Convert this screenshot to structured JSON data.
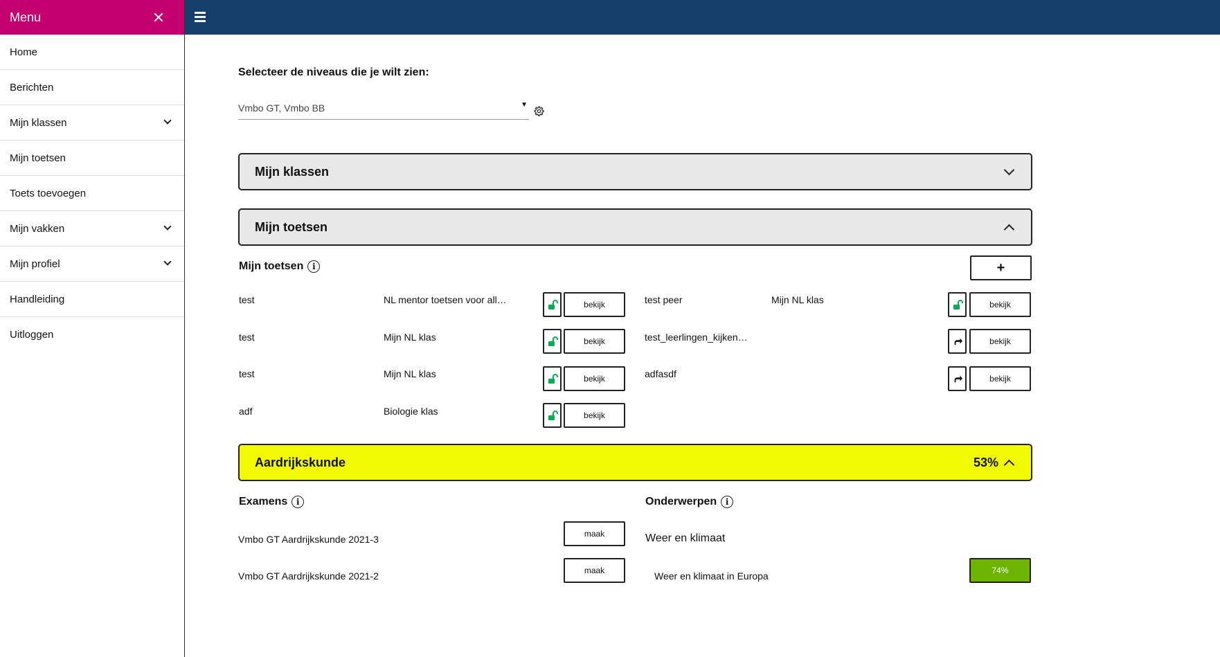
{
  "sidebar": {
    "title": "Menu",
    "items": [
      {
        "label": "Home"
      },
      {
        "label": "Berichten"
      },
      {
        "label": "Mijn klassen"
      },
      {
        "label": "Mijn toetsen"
      },
      {
        "label": "Toets toevoegen"
      },
      {
        "label": "Mijn vakken"
      },
      {
        "label": "Mijn profiel"
      },
      {
        "label": "Handleiding"
      },
      {
        "label": "Uitloggen"
      }
    ]
  },
  "levels": {
    "label": "Selecteer de niveaus die je wilt zien:",
    "selected": "Vmbo GT, Vmbo BB"
  },
  "panels": {
    "klassen": "Mijn klassen",
    "toetsen": "Mijn toetsen",
    "aardrijkskunde": "Aardrijkskunde",
    "aardrijkskunde_pct": "53%"
  },
  "toetsen": {
    "heading": "Mijn toetsen",
    "add_label": "+",
    "view_label": "bekijk",
    "left": [
      {
        "name": "test",
        "class": "NL mentor toetsen voor all…",
        "icon": "lock-open-icon"
      },
      {
        "name": "test",
        "class": "Mijn NL klas",
        "icon": "lock-open-icon"
      },
      {
        "name": "test",
        "class": "Mijn NL klas",
        "icon": "lock-open-icon"
      },
      {
        "name": "adf",
        "class": "Biologie klas",
        "icon": "lock-open-icon"
      }
    ],
    "right": [
      {
        "name": "test peer",
        "class": "Mijn NL klas",
        "icon": "lock-open-icon"
      },
      {
        "name": "test_leerlingen_kijken…",
        "class": "",
        "icon": "share-icon"
      },
      {
        "name": "adfasdf",
        "class": "",
        "icon": "share-icon"
      }
    ]
  },
  "examens": {
    "heading": "Examens",
    "make_label": "maak",
    "items": [
      {
        "name": "Vmbo GT Aardrijkskunde 2021-3"
      },
      {
        "name": "Vmbo GT Aardrijkskunde 2021-2"
      }
    ]
  },
  "onderwerpen": {
    "heading": "Onderwerpen",
    "group": "Weer en klimaat",
    "items": [
      {
        "name": "Weer en klimaat in Europa",
        "progress": "74%"
      }
    ]
  },
  "colors": {
    "menu_header": "#c4006e",
    "topbar": "#163f6e",
    "yellow_panel": "#f1fa00",
    "lock_green": "#00b050",
    "progress_green": "#6cb400"
  }
}
